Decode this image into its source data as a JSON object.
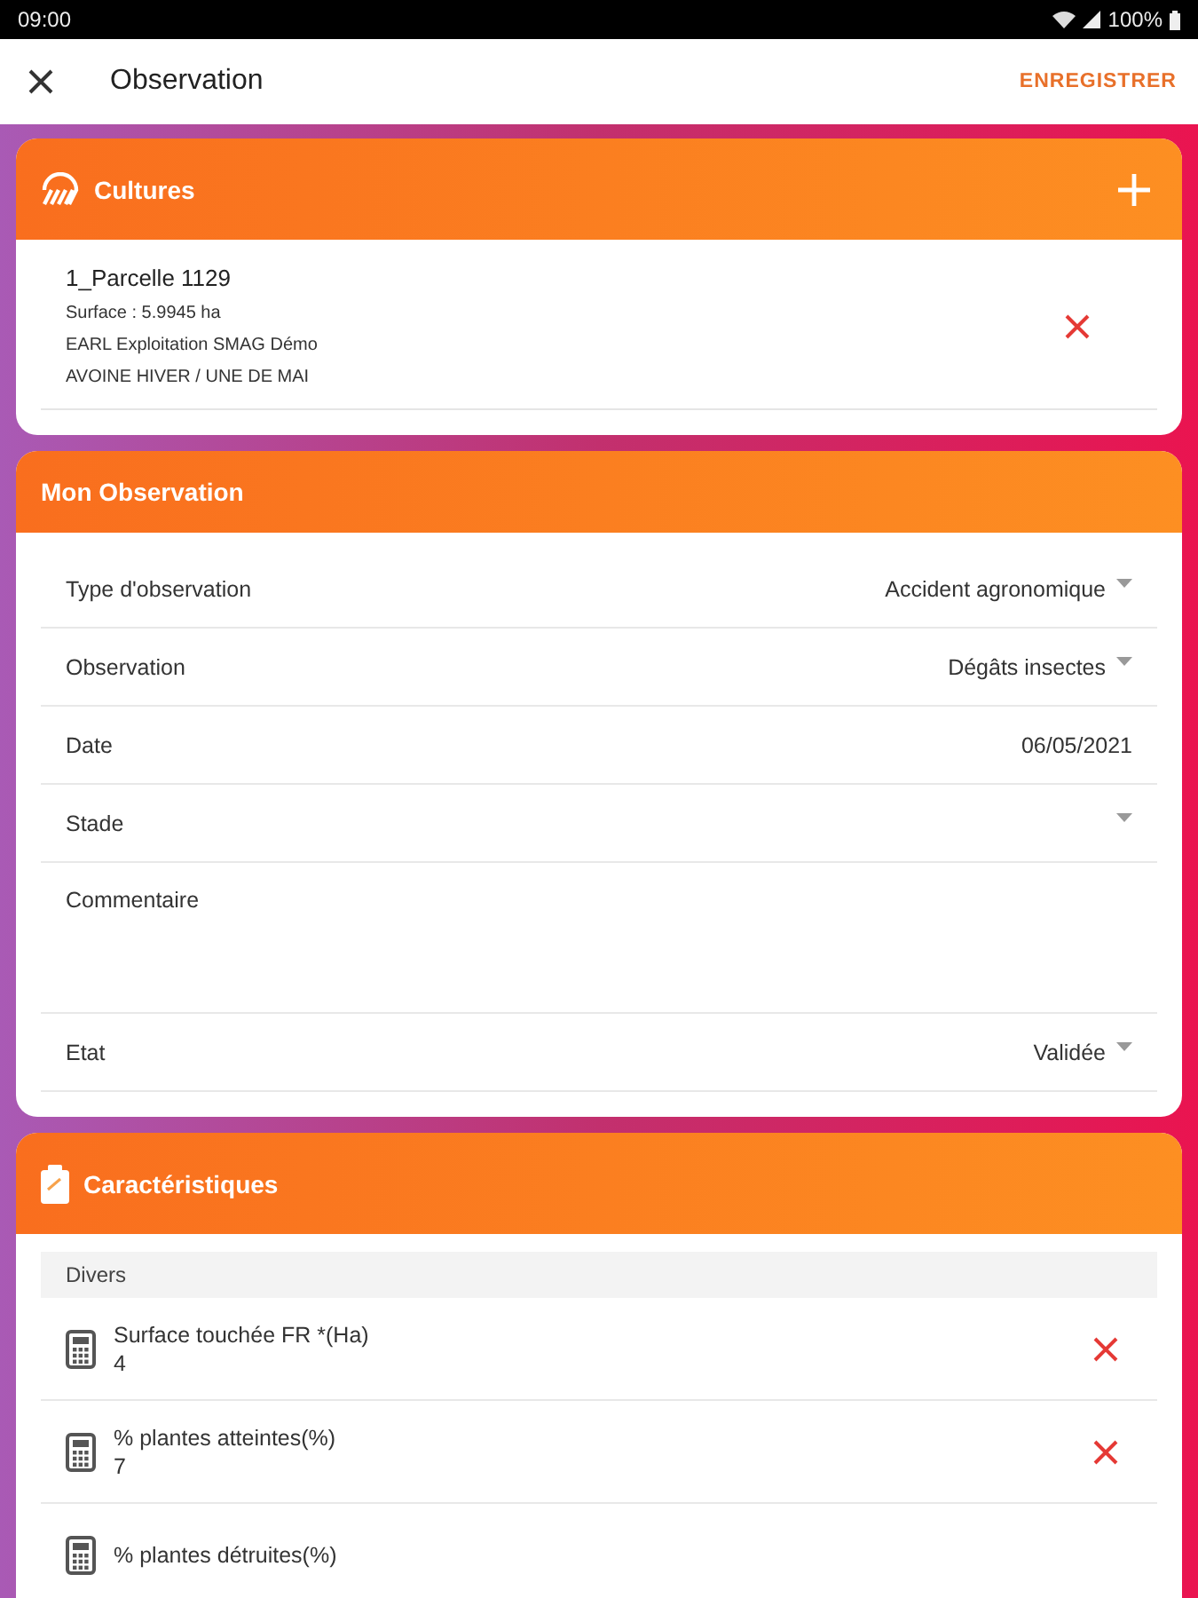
{
  "status_bar": {
    "time": "09:00",
    "battery": "100%"
  },
  "app_bar": {
    "title": "Observation",
    "action": "ENREGISTRER"
  },
  "cultures": {
    "title": "Cultures",
    "items": [
      {
        "name": "1_Parcelle 1129",
        "details": [
          "Surface : 5.9945 ha",
          "EARL Exploitation SMAG Démo",
          "AVOINE HIVER / UNE DE MAI"
        ]
      }
    ]
  },
  "observation": {
    "title": "Mon Observation",
    "fields": [
      {
        "label": "Type d'observation",
        "kind": "select",
        "value": "Accident agronomique"
      },
      {
        "label": "Observation",
        "kind": "select",
        "value": "Dégâts insectes"
      },
      {
        "label": "Date",
        "kind": "date",
        "value": "06/05/2021"
      },
      {
        "label": "Stade",
        "kind": "select"
      },
      {
        "label": "Commentaire",
        "kind": "textarea"
      },
      {
        "label": "Etat",
        "kind": "select",
        "value": "Validée"
      }
    ]
  },
  "caracteristiques": {
    "title": "Caractéristiques",
    "group": "Divers",
    "items": [
      {
        "label": "Surface touchée FR *(Ha)",
        "value": "4",
        "removable": true
      },
      {
        "label": "% plantes atteintes(%)",
        "value": "7",
        "removable": true
      },
      {
        "label": "% plantes détruites(%)",
        "removable": false
      }
    ]
  }
}
